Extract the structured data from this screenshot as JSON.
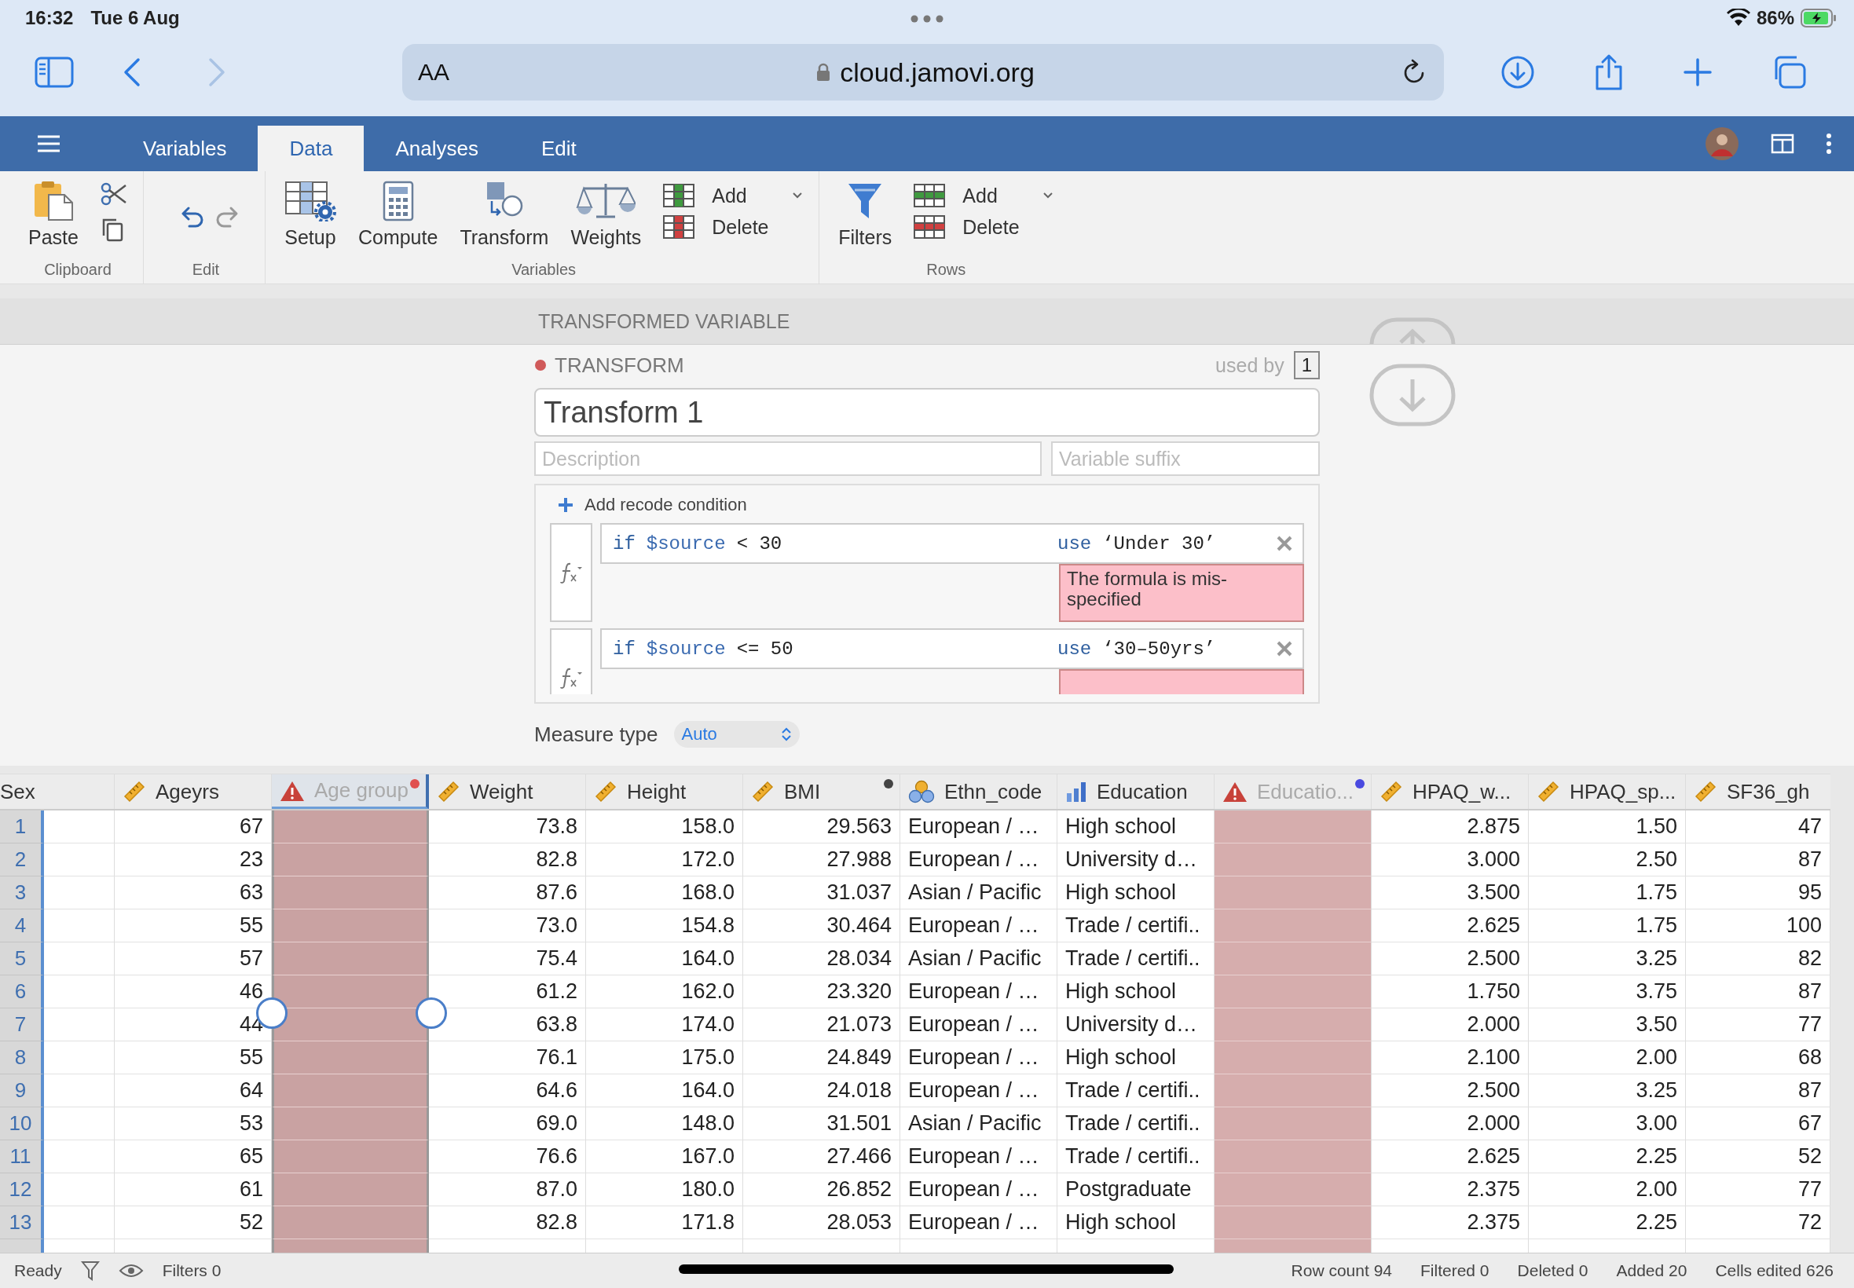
{
  "device_status": {
    "time": "16:32",
    "date": "Tue 6 Aug",
    "battery": "86%"
  },
  "browser": {
    "text_size_button": "AA",
    "url": "cloud.jamovi.org"
  },
  "app_tabs": [
    {
      "label": "Variables",
      "selected": false
    },
    {
      "label": "Data",
      "selected": true
    },
    {
      "label": "Analyses",
      "selected": false
    },
    {
      "label": "Edit",
      "selected": false
    }
  ],
  "ribbon": [
    {
      "label": "Clipboard",
      "tools": [
        {
          "kind": "paste",
          "label": "Paste"
        },
        {
          "kind": "cut-copy"
        }
      ]
    },
    {
      "label": "Edit",
      "tools": [
        {
          "kind": "undo-redo"
        }
      ]
    },
    {
      "label": "Variables",
      "tools": [
        {
          "kind": "setup",
          "label": "Setup"
        },
        {
          "kind": "compute",
          "label": "Compute"
        },
        {
          "kind": "transform",
          "label": "Transform"
        },
        {
          "kind": "weights",
          "label": "Weights"
        },
        {
          "kind": "add-delete-columns",
          "add": "Add",
          "delete": "Delete"
        }
      ]
    },
    {
      "label": "Rows",
      "tools": [
        {
          "kind": "filters",
          "label": "Filters"
        },
        {
          "kind": "add-delete-rows",
          "add": "Add",
          "delete": "Delete"
        }
      ]
    }
  ],
  "panel": {
    "title": "TRANSFORMED VARIABLE",
    "section": "TRANSFORM",
    "used_by_label": "used by",
    "used_by_count": "1",
    "name": "Transform 1",
    "description_placeholder": "Description",
    "suffix_placeholder": "Variable suffix",
    "add_condition": "Add recode condition",
    "conditions": [
      {
        "if_kw": "if",
        "source": "$source",
        "test": "< 30",
        "use_kw": "use",
        "value": "‘Under 30’",
        "has_error": true,
        "error": "The formula is mis-specified"
      },
      {
        "if_kw": "if",
        "source": "$source",
        "test": "<= 50",
        "use_kw": "use",
        "value": "‘30–50yrs’",
        "has_error": true
      }
    ],
    "measure_label": "Measure type",
    "measure_value": "Auto"
  },
  "table": {
    "columns": [
      {
        "name": "Sex",
        "kind": "plain",
        "selected": false
      },
      {
        "name": "Ageyrs",
        "kind": "continuous",
        "selected": false
      },
      {
        "name": "Age group",
        "kind": "error",
        "selected": true,
        "color": "#e05050"
      },
      {
        "name": "Weight",
        "kind": "continuous",
        "selected": false
      },
      {
        "name": "Height",
        "kind": "continuous",
        "selected": false
      },
      {
        "name": "BMI",
        "kind": "continuous",
        "selected": false,
        "color": "#444444"
      },
      {
        "name": "Ethn_code",
        "kind": "nominal",
        "selected": false
      },
      {
        "name": "Education",
        "kind": "ordinal",
        "selected": false
      },
      {
        "name": "Educatio...",
        "kind": "error",
        "selected": false,
        "color": "#4a4ae0"
      },
      {
        "name": "HPAQ_w...",
        "kind": "continuous",
        "selected": false
      },
      {
        "name": "HPAQ_sp...",
        "kind": "continuous",
        "selected": false
      },
      {
        "name": "SF36_gh",
        "kind": "continuous",
        "selected": false
      }
    ],
    "rows": [
      {
        "number": "1",
        "cells": [
          null,
          "67",
          null,
          "73.8",
          "158.0",
          "29.563",
          "European / …",
          "High school",
          null,
          "2.875",
          "1.50",
          "47"
        ]
      },
      {
        "number": "2",
        "cells": [
          null,
          "23",
          null,
          "82.8",
          "172.0",
          "27.988",
          "European / …",
          "University d…",
          null,
          "3.000",
          "2.50",
          "87"
        ]
      },
      {
        "number": "3",
        "cells": [
          null,
          "63",
          null,
          "87.6",
          "168.0",
          "31.037",
          "Asian / Pacific",
          "High school",
          null,
          "3.500",
          "1.75",
          "95"
        ]
      },
      {
        "number": "4",
        "cells": [
          null,
          "55",
          null,
          "73.0",
          "154.8",
          "30.464",
          "European / …",
          "Trade / certifi..",
          null,
          "2.625",
          "1.75",
          "100"
        ]
      },
      {
        "number": "5",
        "cells": [
          null,
          "57",
          null,
          "75.4",
          "164.0",
          "28.034",
          "Asian / Pacific",
          "Trade / certifi..",
          null,
          "2.500",
          "3.25",
          "82"
        ]
      },
      {
        "number": "6",
        "cells": [
          null,
          "46",
          null,
          "61.2",
          "162.0",
          "23.320",
          "European / …",
          "High school",
          null,
          "1.750",
          "3.75",
          "87"
        ]
      },
      {
        "number": "7",
        "cells": [
          null,
          "44",
          null,
          "63.8",
          "174.0",
          "21.073",
          "European / …",
          "University d…",
          null,
          "2.000",
          "3.50",
          "77"
        ]
      },
      {
        "number": "8",
        "cells": [
          null,
          "55",
          null,
          "76.1",
          "175.0",
          "24.849",
          "European / …",
          "High school",
          null,
          "2.100",
          "2.00",
          "68"
        ]
      },
      {
        "number": "9",
        "cells": [
          null,
          "64",
          null,
          "64.6",
          "164.0",
          "24.018",
          "European / …",
          "Trade / certifi..",
          null,
          "2.500",
          "3.25",
          "87"
        ]
      },
      {
        "number": "10",
        "cells": [
          null,
          "53",
          null,
          "69.0",
          "148.0",
          "31.501",
          "Asian / Pacific",
          "Trade / certifi..",
          null,
          "2.000",
          "3.00",
          "67"
        ]
      },
      {
        "number": "11",
        "cells": [
          null,
          "65",
          null,
          "76.6",
          "167.0",
          "27.466",
          "European / …",
          "Trade / certifi..",
          null,
          "2.625",
          "2.25",
          "52"
        ]
      },
      {
        "number": "12",
        "cells": [
          null,
          "61",
          null,
          "87.0",
          "180.0",
          "26.852",
          "European / …",
          "Postgraduate",
          null,
          "2.375",
          "2.00",
          "77"
        ]
      },
      {
        "number": "13",
        "cells": [
          null,
          "52",
          null,
          "82.8",
          "171.8",
          "28.053",
          "European / …",
          "High school",
          null,
          "2.375",
          "2.25",
          "72"
        ]
      }
    ]
  },
  "status_bar": {
    "state": "Ready",
    "filters": "Filters 0",
    "row_count": "Row count 94",
    "filtered": "Filtered 0",
    "deleted": "Deleted 0",
    "added": "Added 20",
    "cells_edited": "Cells edited 626"
  }
}
